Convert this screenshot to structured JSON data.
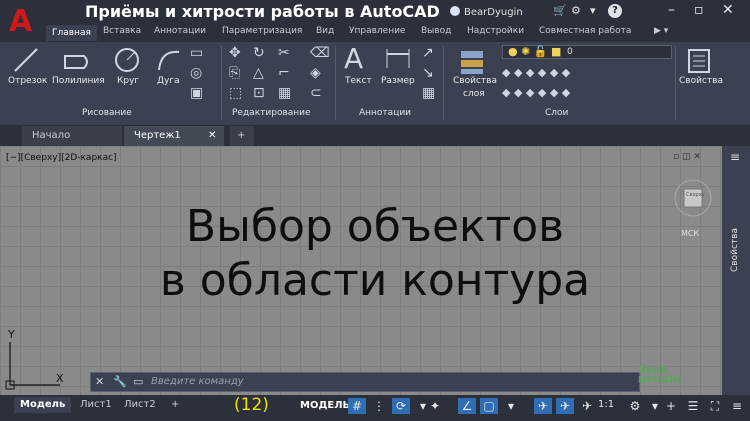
{
  "app": {
    "title": "Приёмы и хитрости работы в AutoCAD",
    "logo": "A",
    "user": "BearDyugin"
  },
  "ribbon_tabs": [
    "Главная",
    "Вставка",
    "Аннотации",
    "Параметризация",
    "Вид",
    "Управление",
    "Вывод",
    "Надстройки",
    "Совместная работа"
  ],
  "ribbon": {
    "draw": {
      "title": "Рисование",
      "tools": [
        "Отрезок",
        "Полилиния",
        "Круг",
        "Дуга"
      ]
    },
    "modify": {
      "title": "Редактирование"
    },
    "annotation": {
      "title": "Аннотации",
      "tools": [
        "Текст",
        "Размер"
      ]
    },
    "layers": {
      "title": "Слои",
      "props_label_1": "Свойства",
      "props_label_2": "слоя",
      "current_layer": "0"
    },
    "properties": {
      "label": "Свойства"
    }
  },
  "doc_tabs": [
    "Начало",
    "Чертеж1"
  ],
  "viewport": {
    "label": "[−][Сверху][2D-каркас]",
    "headline_line1": "Выбор объектов",
    "headline_line2": "в области контура",
    "ucs_label": "МСК",
    "viewcube_face": "Сверху",
    "axis_y": "Y",
    "axis_x": "X",
    "side_panel_label": "Свойства"
  },
  "command_line": {
    "placeholder": "Введите команду"
  },
  "layout_tabs": [
    "Модель",
    "Лист1",
    "Лист2"
  ],
  "status": {
    "counter": "(12)",
    "model_label": "МОДЕЛЬ",
    "scale": "1:1",
    "watermark_1": "BEAR",
    "watermark_2": "DYUGIN"
  },
  "colors": {
    "accent_red": "#d0191d",
    "canvas_gray": "#8a8a8a",
    "counter_yellow": "#f2e200",
    "status_on_blue": "#2f6db5"
  }
}
